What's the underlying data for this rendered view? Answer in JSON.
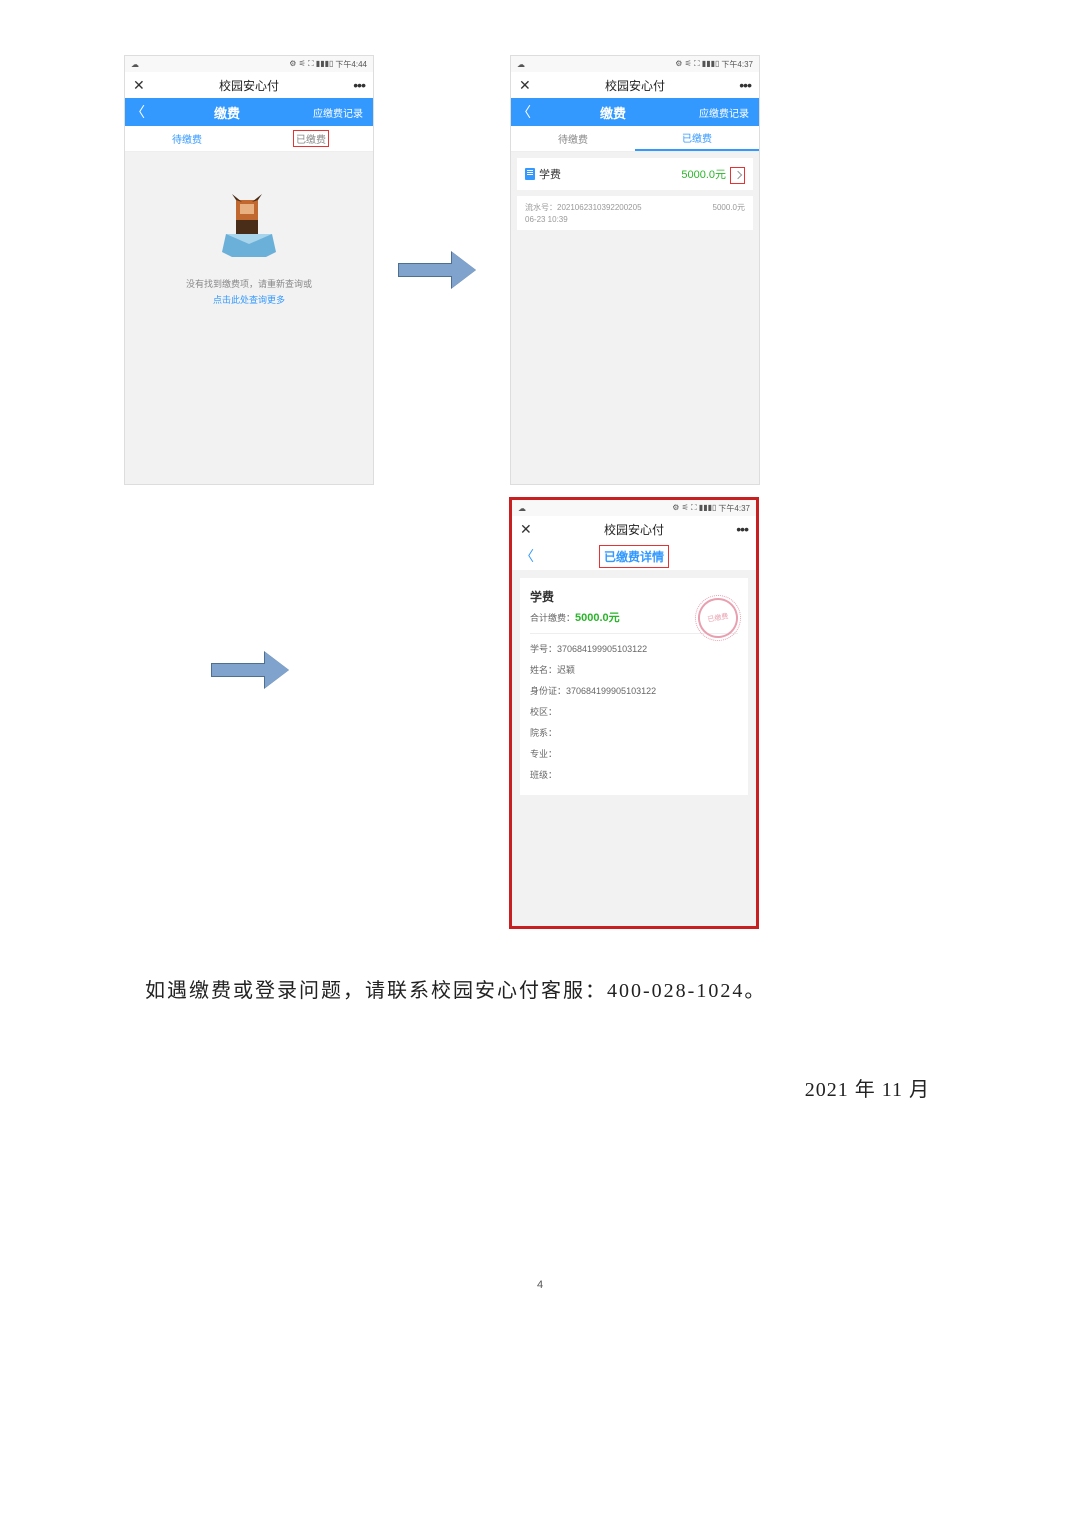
{
  "status": {
    "time1": "下午4:44",
    "time2": "下午4:37",
    "icons": "⚙ ⚟ ⛶ ▮▮▮▯"
  },
  "app": {
    "title": "校园安心付",
    "close": "✕",
    "more": "•••"
  },
  "blue": {
    "back": "〈",
    "title": "缴费",
    "right": "应缴费记录"
  },
  "tabs": {
    "pending": "待缴费",
    "paid": "已缴费"
  },
  "empty": {
    "line1": "没有找到缴费项，请重新查询或",
    "line2": "点击此处查询更多"
  },
  "fee": {
    "name": "学费",
    "amount": "5000.0元",
    "serial_label": "流水号：2021062310392200205",
    "serial_amt": "5000.0元",
    "serial_time": "06-23 10:39"
  },
  "detail": {
    "title": "已缴费详情",
    "name": "学费",
    "total_label": "合计缴费：",
    "total": "5000.0元",
    "stamp": "已缴费",
    "rows": {
      "xh": "学号：370684199905103122",
      "xm": "姓名：迟颖",
      "sfz": "身份证：370684199905103122",
      "xq": "校区：",
      "yx": "院系：",
      "zy": "专业：",
      "bj": "班级："
    }
  },
  "footer": {
    "help": "如遇缴费或登录问题，请联系校园安心付客服：400-028-1024。",
    "date": "2021 年 11 月",
    "page": "4"
  }
}
